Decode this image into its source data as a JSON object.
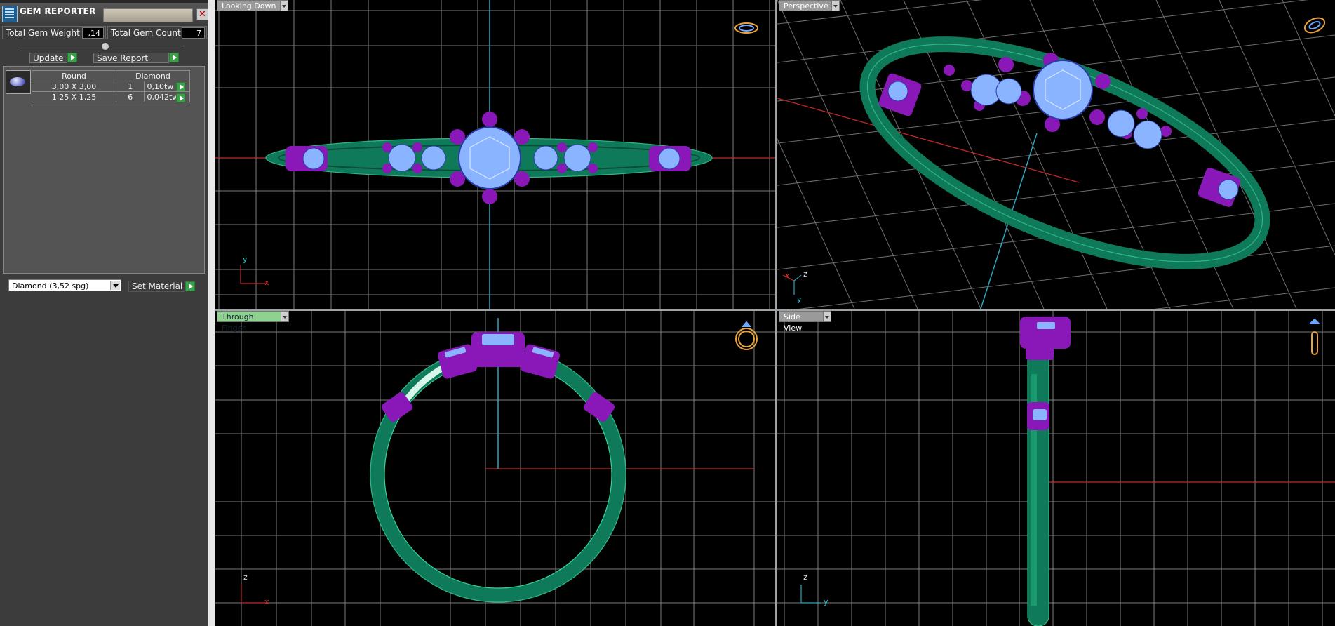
{
  "panel": {
    "title": "GEM REPORTER",
    "total_weight_label": "Total Gem Weight",
    "total_weight_value": ",14",
    "total_count_label": "Total Gem Count",
    "total_count_value": "7",
    "update_label": "Update",
    "save_report_label": "Save Report",
    "gem_table": {
      "headers": [
        "Round",
        "Diamond"
      ],
      "rows": [
        {
          "size": "3,00 X 3,00",
          "qty": "1",
          "weight": "0,10tw"
        },
        {
          "size": "1,25 X 1,25",
          "qty": "6",
          "weight": "0,042tw"
        }
      ]
    },
    "material_value": "Diamond    (3,52 spg)",
    "set_material_label": "Set Material"
  },
  "viewports": {
    "top_left": {
      "label": "Looking Down",
      "axis_a": "y",
      "axis_b": "x"
    },
    "top_right": {
      "label": "Perspective",
      "axis_a": "z",
      "axis_b": "x",
      "axis_c": "y"
    },
    "bottom_left": {
      "label": "Through Finger",
      "axis_a": "z",
      "axis_b": "x"
    },
    "bottom_right": {
      "label": "Side View",
      "axis_a": "z",
      "axis_b": "y"
    }
  },
  "colors": {
    "metal": "#0f7a59",
    "prong": "#8a18b8",
    "gem": "#8ab4ff",
    "grid": "#7c7c7c",
    "axis_red": "#c0282a",
    "axis_cyan": "#2aa6bd",
    "active_tab": "#8fd18f"
  },
  "icons": [
    "gem-reporter-icon",
    "close-icon",
    "play-icon",
    "dropdown-arrow-icon",
    "ring-orientation-icon"
  ]
}
